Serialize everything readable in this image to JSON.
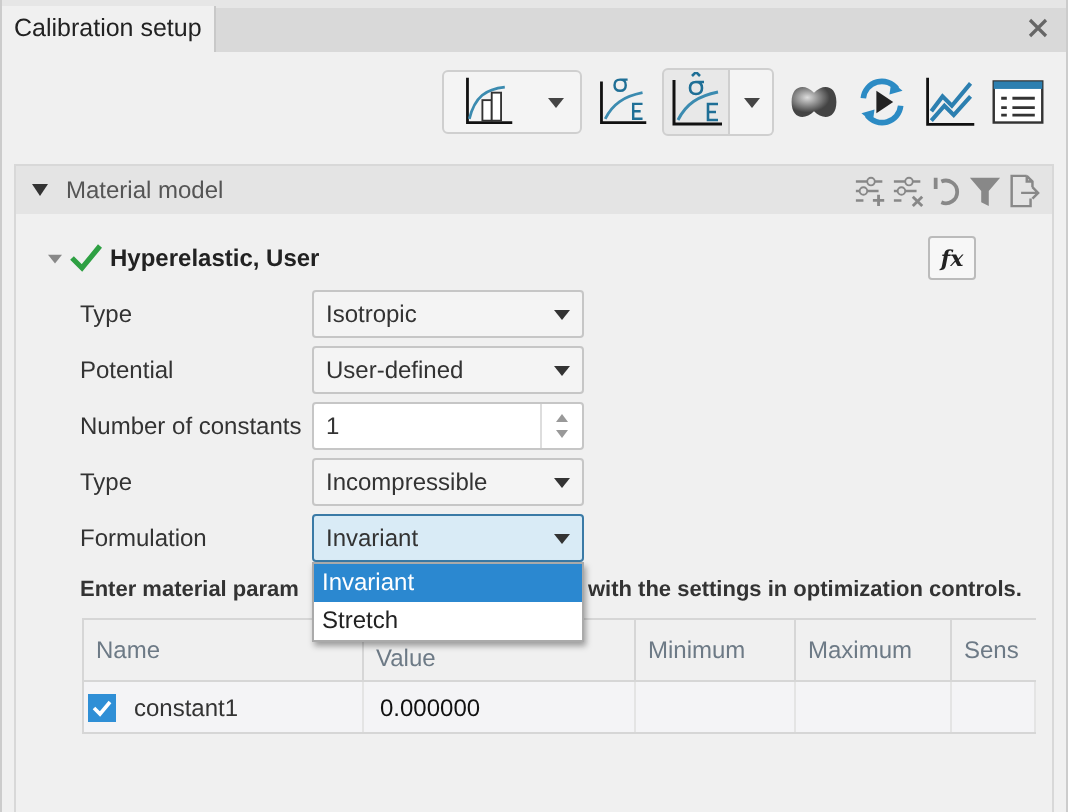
{
  "window": {
    "title": "Calibration setup"
  },
  "section": {
    "title": "Material model",
    "expanded": true
  },
  "model": {
    "name": "Hyperelastic, User",
    "expanded": true,
    "valid": true,
    "formula_button": "fx"
  },
  "fields": [
    {
      "label": "Type",
      "kind": "dropdown",
      "value": "Isotropic",
      "focused": false
    },
    {
      "label": "Potential",
      "kind": "dropdown",
      "value": "User-defined",
      "focused": false
    },
    {
      "label": "Number of constants",
      "kind": "spinner",
      "value": "1",
      "focused": false
    },
    {
      "label": "Type",
      "kind": "dropdown",
      "value": "Incompressible",
      "focused": false
    },
    {
      "label": "Formulation",
      "kind": "dropdown",
      "value": "Invariant",
      "focused": true,
      "open": true
    }
  ],
  "dropdown_list": {
    "options": [
      {
        "label": "Invariant",
        "selected": true
      },
      {
        "label": "Stretch",
        "selected": false
      }
    ]
  },
  "instruction": [
    "Enter material param",
    "with the settings in optimization controls."
  ],
  "table": {
    "columns": [
      "Name",
      "Value",
      "Minimum",
      "Maximum",
      "Sens"
    ],
    "rows": [
      {
        "checked": true,
        "name": "constant1",
        "value": "0.000000"
      }
    ]
  }
}
